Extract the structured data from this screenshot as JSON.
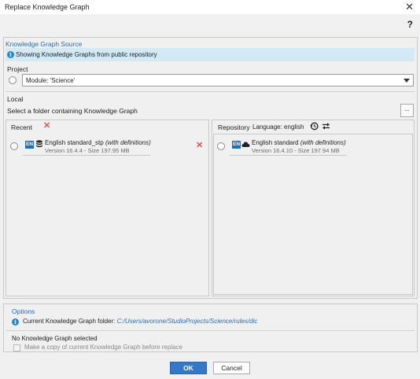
{
  "window": {
    "title": "Replace Knowledge Graph",
    "close_glyph": "✕",
    "help_glyph": "?"
  },
  "source": {
    "group_title": "Knowledge Graph Source",
    "info_text": "Showing Knowledge Graphs from public repository",
    "project_label": "Project",
    "project_value": "Module: 'Science'",
    "local_label": "Local",
    "local_hint": "Select a folder containing Knowledge Graph",
    "browse_label": "..."
  },
  "recent": {
    "header": "Recent",
    "items": [
      {
        "lang": "EN",
        "name": "English standard_stp",
        "note": "(with definitions)",
        "meta": "Version 16.4.4 - Size 197.95 MB"
      }
    ]
  },
  "repository": {
    "header": "Repository",
    "language_label": "Language: english",
    "items": [
      {
        "lang": "EN",
        "name": "English standard",
        "note": "(with definitions)",
        "meta": "Version 16.4.10 - Size 197.94 MB"
      }
    ]
  },
  "options": {
    "group_title": "Options",
    "current_label": "Current Knowledge Graph folder:",
    "current_path": "C:/Users/avorone/StudioProjects/Science/rules/dic",
    "status": "No Knowledge Graph selected",
    "copy_checkbox_label": "Make a copy of current Knowledge Graph before replace"
  },
  "buttons": {
    "ok": "OK",
    "cancel": "Cancel"
  },
  "colors": {
    "accent": "#3478c7",
    "info_bg": "#d2e9f6",
    "delete_red": "#d9534f",
    "lang_badge": "#1f6fb5"
  }
}
